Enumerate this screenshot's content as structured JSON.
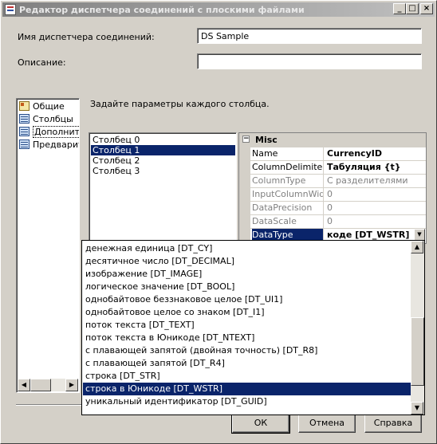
{
  "window": {
    "title": "Редактор диспетчера соединений с плоскими файлами",
    "controls": [
      "_",
      "□",
      "×"
    ]
  },
  "form": {
    "name_label": "Имя диспетчера соединений:",
    "name_value": "DS Sample",
    "description_label": "Описание:",
    "description_value": ""
  },
  "nav": {
    "items": [
      {
        "label": "Общие",
        "icon": "general-icon"
      },
      {
        "label": "Столбцы",
        "icon": "columns-icon"
      },
      {
        "label": "Дополните",
        "icon": "advanced-icon"
      },
      {
        "label": "Предварит",
        "icon": "preview-icon"
      }
    ]
  },
  "instruction": "Задайте параметры каждого столбца.",
  "columns": {
    "items": [
      "Столбец 0",
      "Столбец 1",
      "Столбец 2",
      "Столбец 3"
    ],
    "selected": "Столбец 1"
  },
  "properties": {
    "category": "Misc",
    "toggle": "⊟",
    "rows": [
      {
        "name": "Name",
        "value": "CurrencyID"
      },
      {
        "name": "ColumnDelimiter",
        "value": "Табуляция {t}"
      },
      {
        "name": "ColumnType",
        "value": "С разделителями"
      },
      {
        "name": "InputColumnWidth",
        "value": "0"
      },
      {
        "name": "DataPrecision",
        "value": "0"
      },
      {
        "name": "DataScale",
        "value": "0"
      },
      {
        "name": "DataType",
        "value": "коде [DT_WSTR]"
      }
    ]
  },
  "datatype_dropdown": {
    "items": [
      "денежная единица [DT_CY]",
      "десятичное число [DT_DECIMAL]",
      "изображение [DT_IMAGE]",
      "логическое значение [DT_BOOL]",
      "однобайтовое беззнаковое целое [DT_UI1]",
      "однобайтовое целое со знаком [DT_I1]",
      "поток текста [DT_TEXT]",
      "поток текста в Юникоде [DT_NTEXT]",
      "с плавающей запятой (двойная точность) [DT_R8]",
      "с плавающей запятой [DT_R4]",
      "строка [DT_STR]",
      "строка в Юникоде [DT_WSTR]",
      "уникальный идентификатор [DT_GUID]"
    ],
    "selected": "строка в Юникоде [DT_WSTR]"
  },
  "buttons": {
    "ok": "ОК",
    "cancel": "Отмена",
    "help": "Справка"
  },
  "colors": {
    "selection": "#0a246a",
    "dialog_bg": "#d4d0c8"
  }
}
